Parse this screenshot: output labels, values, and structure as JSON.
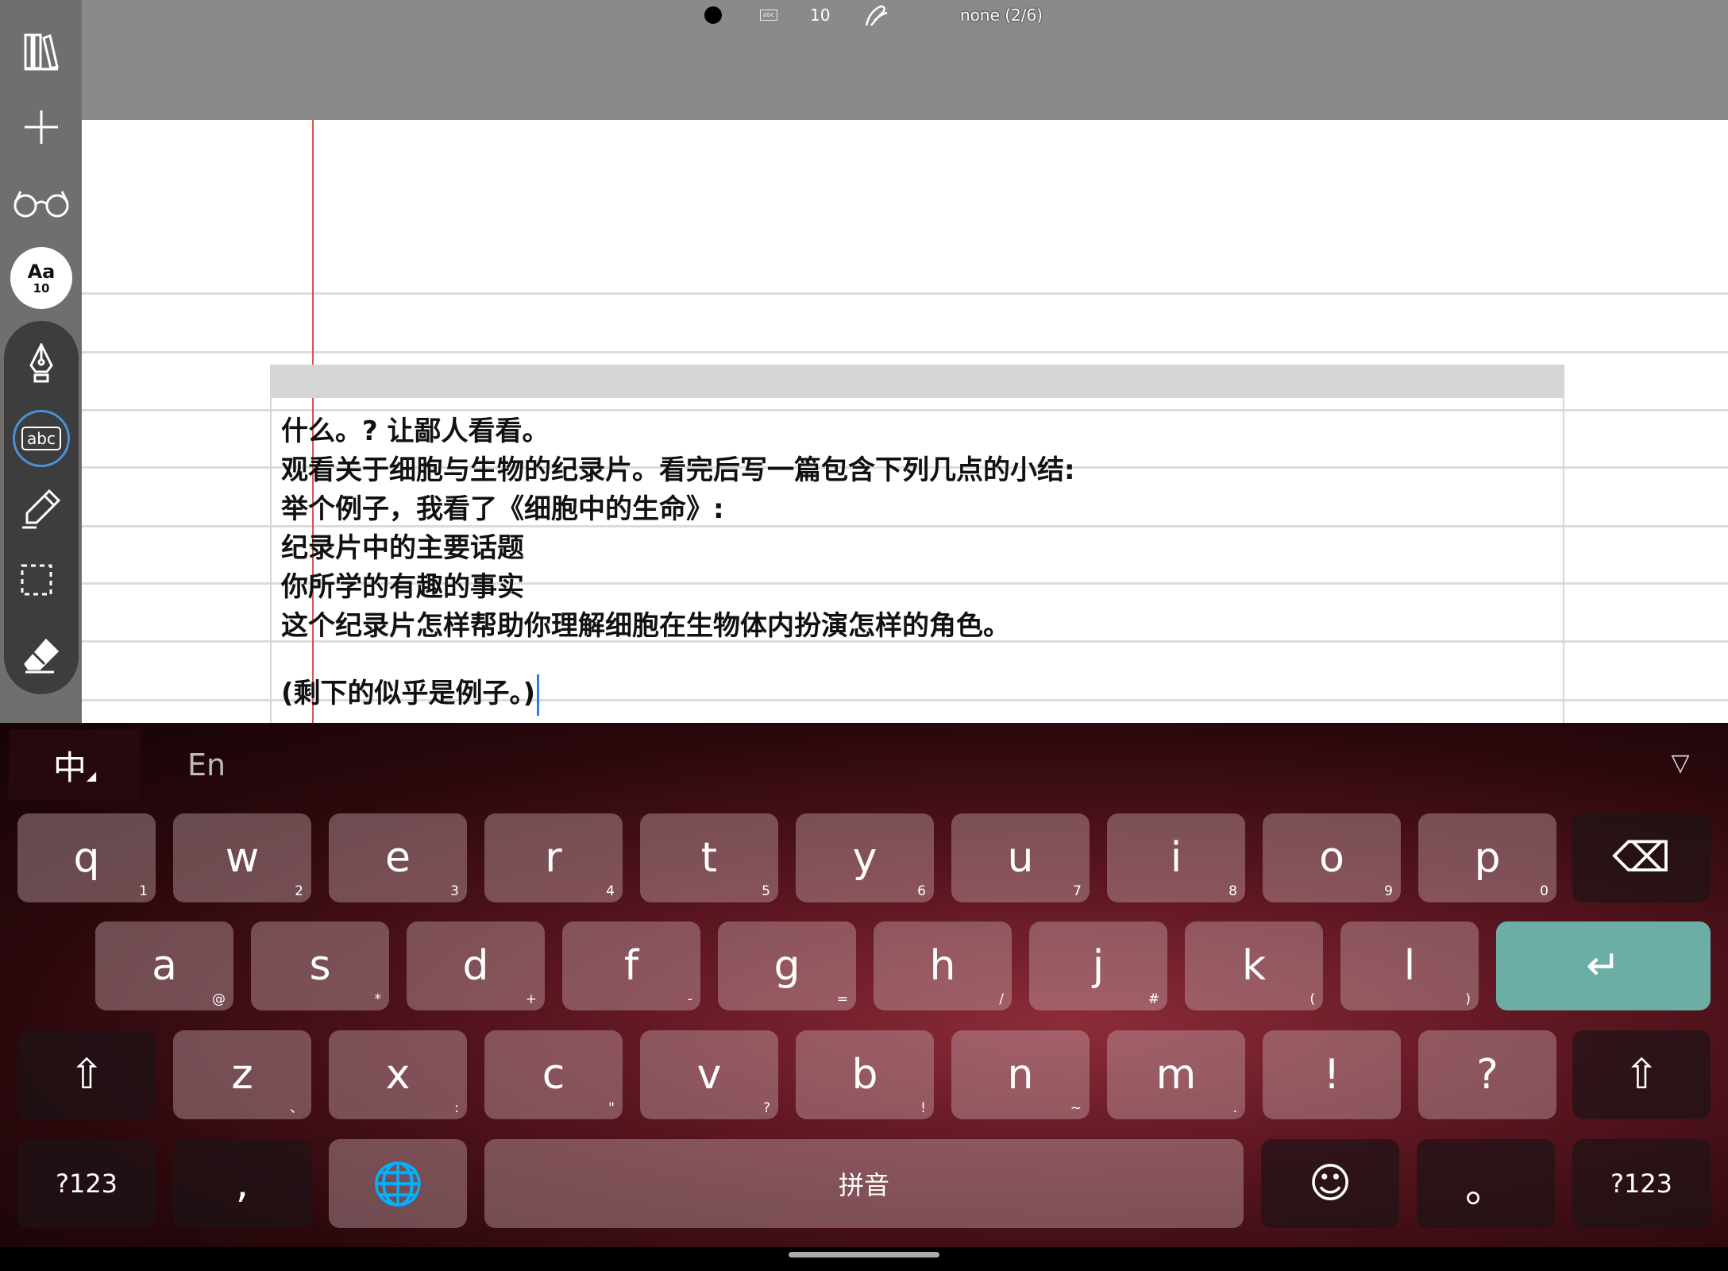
{
  "topbar": {
    "zoom": "10",
    "layer_status": "none (2/6)",
    "icons": [
      "dot-icon",
      "textbox-icon",
      "ink-icon"
    ]
  },
  "sidebar": {
    "font_label": "Aa",
    "font_size": "10",
    "icons": [
      "library-icon",
      "add-icon",
      "reading-glasses-icon",
      "pen-icon",
      "text-tool-icon",
      "highlighter-icon",
      "lasso-select-icon",
      "eraser-icon"
    ],
    "text_tool_label": "abc"
  },
  "document": {
    "lines": [
      "什么。? 让鄙人看看。",
      "观看关于细胞与生物的纪录片。看完后写一篇包含下列几点的小结:",
      "举个例子，我看了《细胞中的生命》:",
      "纪录片中的主要话题",
      "你所学的有趣的事实",
      "这个纪录片怎样帮助你理解细胞在生物体内扮演怎样的角色。",
      "",
      "(剩下的似乎是例子。)"
    ]
  },
  "keyboard": {
    "lang_cn": "中",
    "lang_en": "En",
    "collapse": "▽",
    "row1": [
      {
        "k": "q",
        "h": "1"
      },
      {
        "k": "w",
        "h": "2"
      },
      {
        "k": "e",
        "h": "3"
      },
      {
        "k": "r",
        "h": "4"
      },
      {
        "k": "t",
        "h": "5"
      },
      {
        "k": "y",
        "h": "6"
      },
      {
        "k": "u",
        "h": "7"
      },
      {
        "k": "i",
        "h": "8"
      },
      {
        "k": "o",
        "h": "9"
      },
      {
        "k": "p",
        "h": "0"
      }
    ],
    "row2": [
      {
        "k": "a",
        "h": "@"
      },
      {
        "k": "s",
        "h": "*"
      },
      {
        "k": "d",
        "h": "+"
      },
      {
        "k": "f",
        "h": "-"
      },
      {
        "k": "g",
        "h": "="
      },
      {
        "k": "h",
        "h": "/"
      },
      {
        "k": "j",
        "h": "#"
      },
      {
        "k": "k",
        "h": "("
      },
      {
        "k": "l",
        "h": ")"
      }
    ],
    "row3": [
      {
        "k": "z",
        "h": "、"
      },
      {
        "k": "x",
        "h": ":"
      },
      {
        "k": "c",
        "h": "\""
      },
      {
        "k": "v",
        "h": "?"
      },
      {
        "k": "b",
        "h": "!"
      },
      {
        "k": "n",
        "h": "~"
      },
      {
        "k": "m",
        "h": "."
      },
      {
        "k": "!",
        "h": ""
      },
      {
        "k": "?",
        "h": ""
      }
    ],
    "symbols_left": "?123",
    "comma": ",",
    "space": "拼音",
    "period": "。",
    "symbols_right": "?123",
    "enter_symbol": "↵",
    "backspace_symbol": "⌫",
    "shift_symbol": "⇧"
  }
}
